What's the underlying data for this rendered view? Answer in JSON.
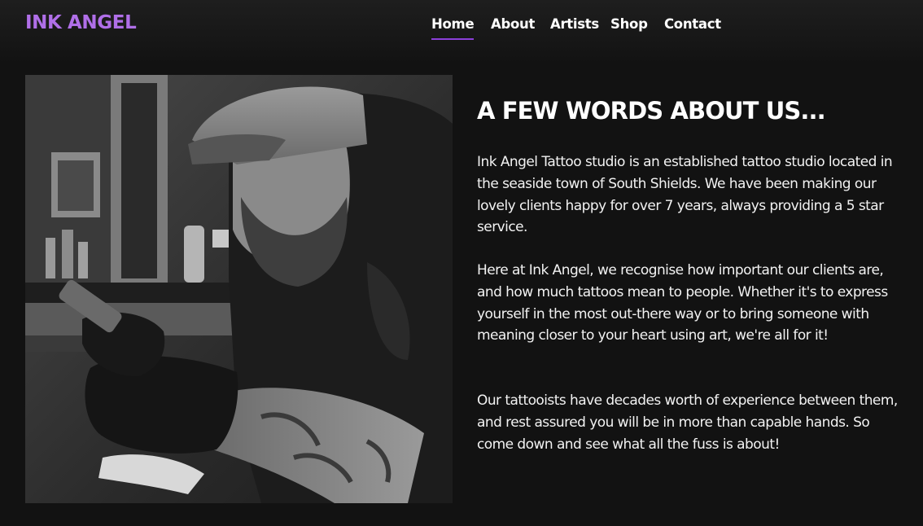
{
  "brand": {
    "logo_text": "INK ANGEL",
    "accent_color": "#b06fe8",
    "underline_color": "#8b3fd9"
  },
  "nav": {
    "items": [
      {
        "label": "Home",
        "active": true
      },
      {
        "label": "About",
        "active": false
      },
      {
        "label": "Artists",
        "active": false
      },
      {
        "label": "Shop",
        "active": false
      },
      {
        "label": "Contact",
        "active": false
      }
    ]
  },
  "about": {
    "heading": "A FEW WORDS ABOUT US...",
    "paragraphs": [
      "Ink Angel Tattoo studio is an established tattoo studio located in the seaside town of South Shields. We have been making our lovely clients happy for over 7 years, always providing a 5 star service.",
      "Here at Ink Angel, we recognise how important our clients are, and how much tattoos mean to people. Whether it's to express yourself in the most out-there way or to bring someone with meaning closer to your heart using art, we're all for it!",
      "Our tattooists have decades worth of experience between them, and rest assured you will be in more than capable hands. So come down and see what all the fuss is about!"
    ]
  },
  "colors": {
    "background": "#121212",
    "text": "#ffffff"
  }
}
